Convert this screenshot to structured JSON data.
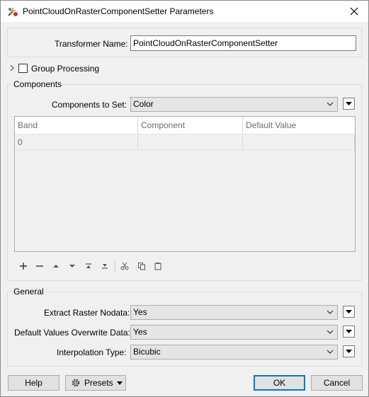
{
  "window": {
    "title": "PointCloudOnRasterComponentSetter Parameters"
  },
  "transformer": {
    "label": "Transformer Name:",
    "value": "PointCloudOnRasterComponentSetter"
  },
  "group_processing": {
    "label": "Group Processing",
    "checked": false
  },
  "components": {
    "section_title": "Components",
    "set_label": "Components to Set:",
    "set_value": "Color",
    "table": {
      "columns": [
        "Band",
        "Component",
        "Default Value"
      ],
      "rows": [
        [
          "0",
          "",
          ""
        ]
      ]
    }
  },
  "toolbar": {
    "icons": [
      "add-icon",
      "remove-icon",
      "move-up-icon",
      "move-down-icon",
      "move-top-icon",
      "move-bottom-icon",
      "cut-icon",
      "copy-icon",
      "paste-icon"
    ]
  },
  "general": {
    "section_title": "General",
    "extract_label": "Extract Raster Nodata:",
    "extract_value": "Yes",
    "overwrite_label": "Default Values Overwrite Data:",
    "overwrite_value": "Yes",
    "interp_label": "Interpolation Type:",
    "interp_value": "Bicubic"
  },
  "buttons": {
    "help": "Help",
    "presets": "Presets",
    "ok": "OK",
    "cancel": "Cancel"
  },
  "colors": {
    "accent": "#0078d7",
    "window_bg": "#f0f0f0"
  }
}
